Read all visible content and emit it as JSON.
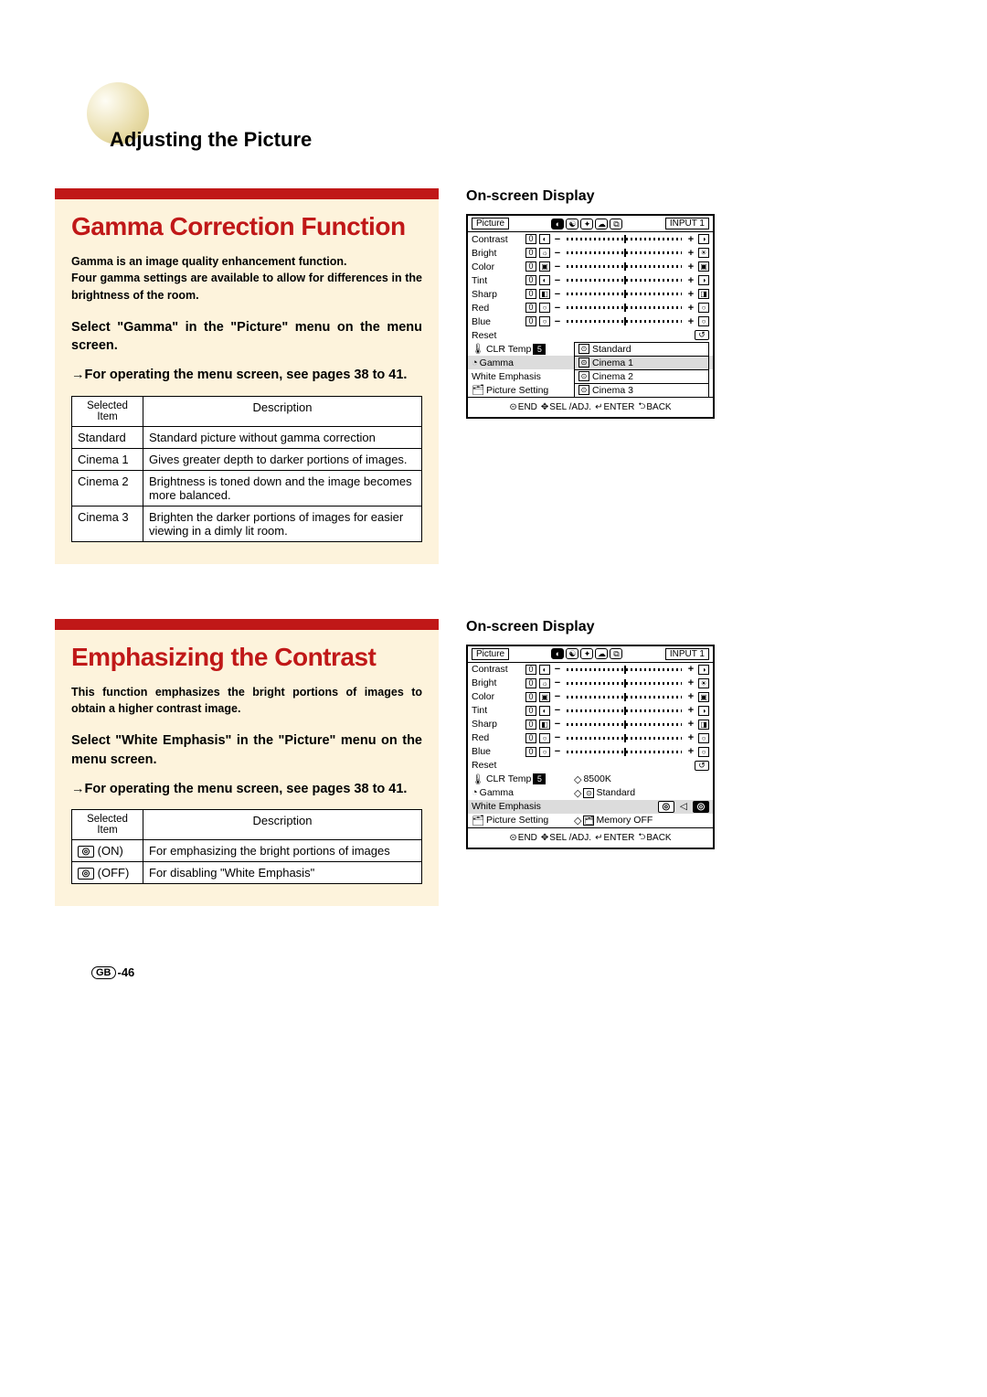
{
  "pageTitle": "Adjusting the Picture",
  "pageNumber": "-46",
  "pagePrefix": "GB",
  "sections": [
    {
      "title": "Gamma Correction Function",
      "intro": "Gamma is an image quality enhancement function.\nFour gamma settings are available to allow for differences in the brightness of the room.",
      "instruction1": "Select \"Gamma\" in the \"Picture\" menu on the menu screen.",
      "instruction2": "For operating the menu screen, see pages 38 to 41.",
      "tableHeaders": [
        "Selected Item",
        "Description"
      ],
      "tableRows": [
        [
          "Standard",
          "Standard picture without gamma correction"
        ],
        [
          "Cinema 1",
          "Gives greater depth to darker portions of images."
        ],
        [
          "Cinema 2",
          "Brightness is toned down and the image becomes more balanced."
        ],
        [
          "Cinema 3",
          "Brighten the darker portions of images for easier viewing in a dimly lit room."
        ]
      ],
      "osdTitle": "On-screen Display",
      "osd": {
        "tab": "Picture",
        "input": "INPUT 1",
        "sliders": [
          "Contrast",
          "Bright",
          "Color",
          "Tint",
          "Sharp",
          "Red",
          "Blue"
        ],
        "reset": "Reset",
        "clrTemp": {
          "label": "CLR Temp",
          "chip": "5"
        },
        "gamma": {
          "label": "Gamma",
          "selected": "Standard",
          "options": [
            "Standard",
            "Cinema 1",
            "Cinema 2",
            "Cinema 3"
          ]
        },
        "whiteEmphasis": "White Emphasis",
        "pictureSetting": "Picture Setting",
        "footer": [
          "END",
          "SEL /ADJ.",
          "ENTER",
          "BACK"
        ]
      }
    },
    {
      "title": "Emphasizing the Contrast",
      "intro": "This function emphasizes the bright portions of images to obtain a higher contrast image.",
      "instruction1": "Select \"White Emphasis\" in the \"Picture\" menu on the menu screen.",
      "instruction2": "For operating the menu screen, see pages 38 to 41.",
      "tableHeaders": [
        "Selected Item",
        "Description"
      ],
      "tableRows": [
        [
          "(ON)",
          "For emphasizing the bright portions of images"
        ],
        [
          "(OFF)",
          "For disabling \"White Emphasis\""
        ]
      ],
      "osdTitle": "On-screen Display",
      "osd": {
        "tab": "Picture",
        "input": "INPUT 1",
        "sliders": [
          "Contrast",
          "Bright",
          "Color",
          "Tint",
          "Sharp",
          "Red",
          "Blue"
        ],
        "reset": "Reset",
        "clrTemp": {
          "label": "CLR Temp",
          "chip": "5",
          "val": "8500K"
        },
        "gamma": {
          "label": "Gamma",
          "val": "Standard"
        },
        "whiteEmphasis": "White Emphasis",
        "pictureSetting": {
          "label": "Picture Setting",
          "val": "Memory OFF"
        },
        "footer": [
          "END",
          "SEL /ADJ.",
          "ENTER",
          "BACK"
        ]
      }
    }
  ]
}
